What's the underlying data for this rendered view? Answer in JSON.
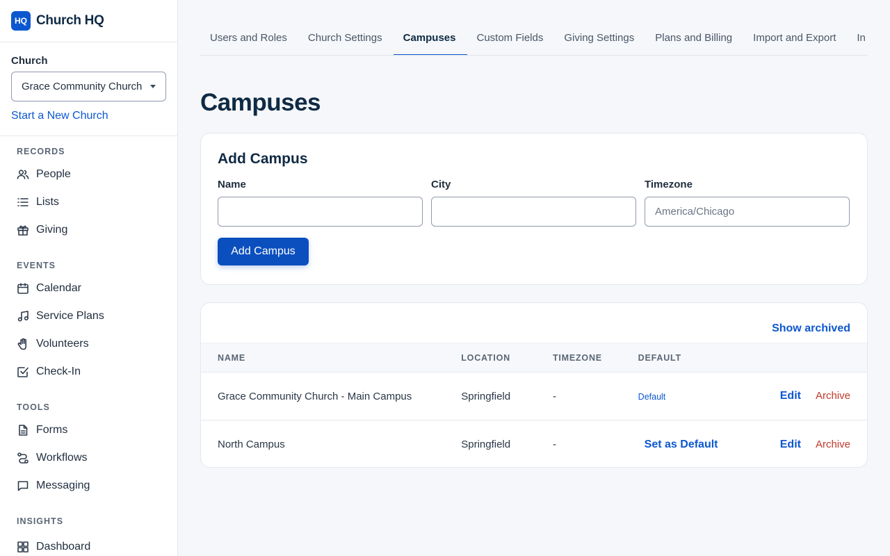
{
  "app": {
    "logo_text": "HQ",
    "name": "Church HQ"
  },
  "church_picker": {
    "label": "Church",
    "selected": "Grace Community Church - Main Campus",
    "new_church_link": "Start a New Church"
  },
  "nav": {
    "sections": [
      {
        "heading": "RECORDS",
        "items": [
          {
            "label": "People",
            "icon": "people-icon"
          },
          {
            "label": "Lists",
            "icon": "list-icon"
          },
          {
            "label": "Giving",
            "icon": "gift-icon"
          }
        ]
      },
      {
        "heading": "EVENTS",
        "items": [
          {
            "label": "Calendar",
            "icon": "calendar-icon"
          },
          {
            "label": "Service Plans",
            "icon": "music-note-icon"
          },
          {
            "label": "Volunteers",
            "icon": "hand-icon"
          },
          {
            "label": "Check-In",
            "icon": "checkbox-icon"
          }
        ]
      },
      {
        "heading": "TOOLS",
        "items": [
          {
            "label": "Forms",
            "icon": "document-icon"
          },
          {
            "label": "Workflows",
            "icon": "workflow-icon"
          },
          {
            "label": "Messaging",
            "icon": "message-icon"
          }
        ]
      },
      {
        "heading": "INSIGHTS",
        "items": [
          {
            "label": "Dashboard",
            "icon": "dashboard-icon"
          }
        ]
      }
    ]
  },
  "tabs": [
    {
      "label": "Users and Roles",
      "active": false
    },
    {
      "label": "Church Settings",
      "active": false
    },
    {
      "label": "Campuses",
      "active": true
    },
    {
      "label": "Custom Fields",
      "active": false
    },
    {
      "label": "Giving Settings",
      "active": false
    },
    {
      "label": "Plans and Billing",
      "active": false
    },
    {
      "label": "Import and Export",
      "active": false
    },
    {
      "label": "In",
      "active": false
    }
  ],
  "page": {
    "title": "Campuses"
  },
  "add_campus": {
    "title": "Add Campus",
    "name_label": "Name",
    "name_value": "",
    "city_label": "City",
    "city_value": "",
    "timezone_label": "Timezone",
    "timezone_placeholder": "America/Chicago",
    "submit_label": "Add Campus"
  },
  "campus_list": {
    "show_archived": "Show archived",
    "columns": {
      "name": "NAME",
      "location": "LOCATION",
      "timezone": "TIMEZONE",
      "default": "DEFAULT"
    },
    "rows": [
      {
        "name": "Grace Community Church - Main Campus",
        "location": "Springfield",
        "timezone": "-",
        "default_text": "Default",
        "is_default": true,
        "edit": "Edit",
        "archive": "Archive"
      },
      {
        "name": "North Campus",
        "location": "Springfield",
        "timezone": "-",
        "default_text": "Set as Default",
        "is_default": false,
        "edit": "Edit",
        "archive": "Archive"
      }
    ]
  },
  "colors": {
    "accent": "#0b57d0",
    "primary_button": "#0b4fbf",
    "danger": "#c0392b",
    "heading": "#0f2a44"
  }
}
